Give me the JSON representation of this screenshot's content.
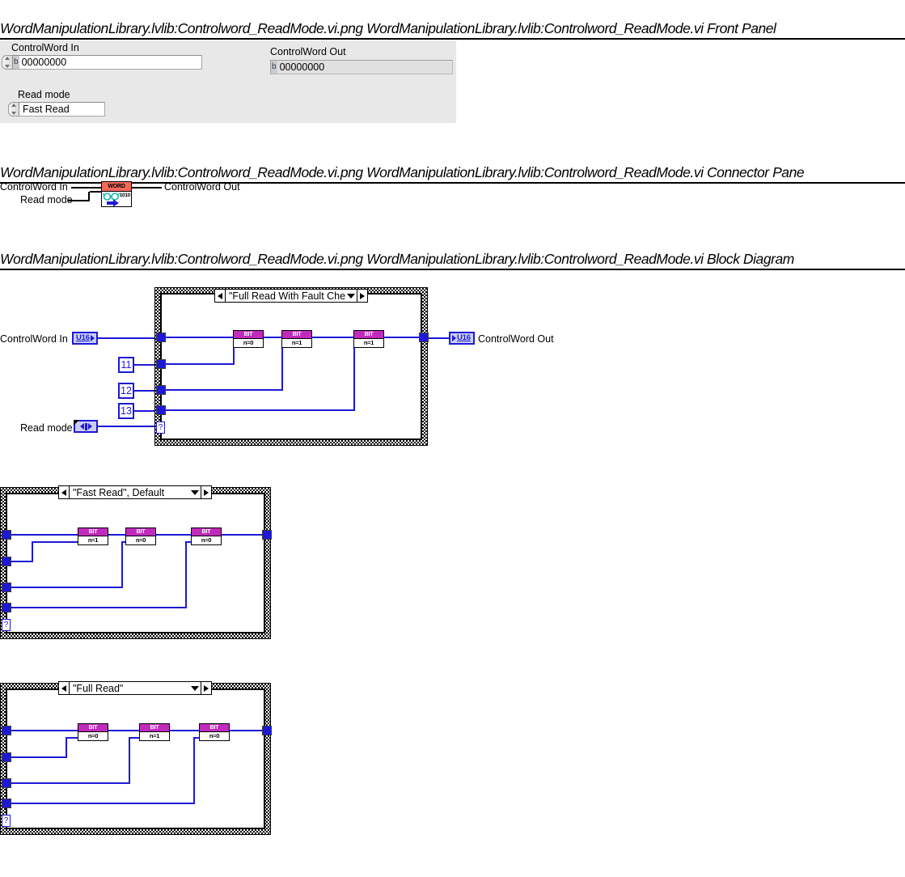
{
  "sections": {
    "front_panel_title": "WordManipulationLibrary.lvlib:Controlword_ReadMode.vi.png  WordManipulationLibrary.lvlib:Controlword_ReadMode.vi Front Panel",
    "connector_title": "WordManipulationLibrary.lvlib:Controlword_ReadMode.vi.png  WordManipulationLibrary.lvlib:Controlword_ReadMode.vi Connector Pane",
    "block_title": "WordManipulationLibrary.lvlib:Controlword_ReadMode.vi.png  WordManipulationLibrary.lvlib:Controlword_ReadMode.vi Block Diagram"
  },
  "front_panel": {
    "controlword_in": {
      "label": "ControlWord In",
      "radix": "b",
      "value": "00000000"
    },
    "controlword_out": {
      "label": "ControlWord Out",
      "radix": "b",
      "value": "00000000"
    },
    "read_mode": {
      "label": "Read mode",
      "value": "Fast Read",
      "options": [
        "Fast Read",
        "Full Read",
        "Full Read With Fault Check"
      ]
    }
  },
  "connector_pane": {
    "input_1": "ControlWord In",
    "input_2": "Read mode",
    "output_1": "ControlWord Out",
    "icon": {
      "band_text": "WORD",
      "bits_text": "1010",
      "band_color": "#f4675c"
    }
  },
  "block_diagram": {
    "input_terminal": "U16",
    "input_label": "ControlWord In",
    "output_terminal": "U16",
    "output_label": "ControlWord Out",
    "read_mode_label": "Read mode",
    "constants": [
      "11",
      "12",
      "13"
    ],
    "cases": [
      {
        "selector": "\"Full Read With Fault Check\"",
        "bit_nodes": [
          {
            "title": "BIT",
            "n": "n=0"
          },
          {
            "title": "BIT",
            "n": "n=1"
          },
          {
            "title": "BIT",
            "n": "n=1"
          }
        ],
        "tunnel_marker": "?"
      },
      {
        "selector": "\"Fast Read\", Default",
        "bit_nodes": [
          {
            "title": "BIT",
            "n": "n=1"
          },
          {
            "title": "BIT",
            "n": "n=0"
          },
          {
            "title": "BIT",
            "n": "n=0"
          }
        ],
        "tunnel_marker": "?"
      },
      {
        "selector": "\"Full Read\"",
        "bit_nodes": [
          {
            "title": "BIT",
            "n": "n=0"
          },
          {
            "title": "BIT",
            "n": "n=1"
          },
          {
            "title": "BIT",
            "n": "n=0"
          }
        ],
        "tunnel_marker": "?"
      }
    ]
  },
  "colors": {
    "wire": "#1d18d8",
    "bit_header": "#c12bbd",
    "icon_band": "#f4675c",
    "panel_bg": "#e8e8e8"
  }
}
